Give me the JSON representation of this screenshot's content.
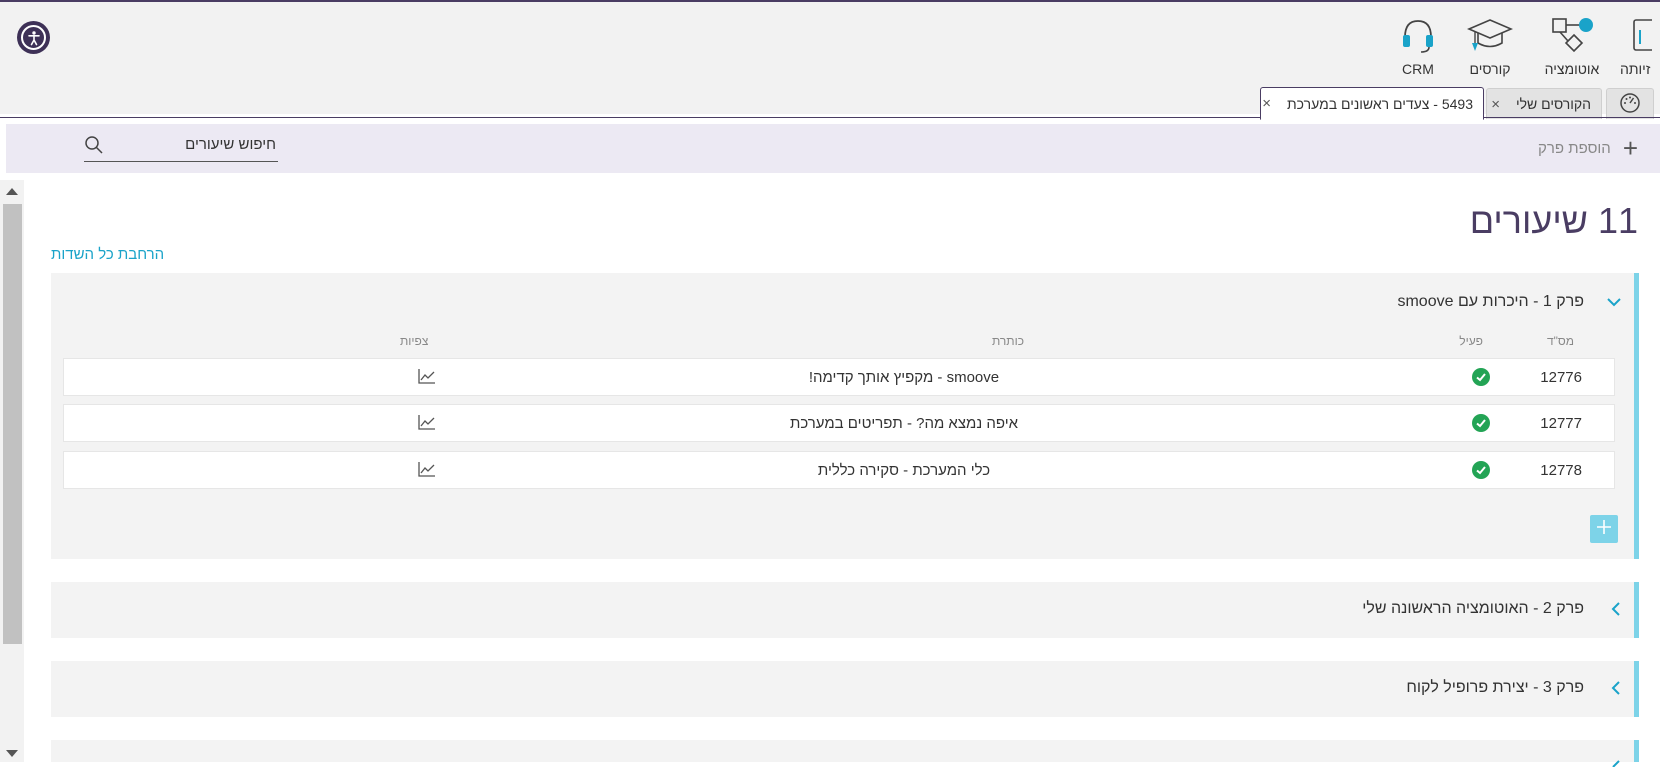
{
  "toolbar": {
    "items": [
      {
        "label": "זיותה",
        "icon": "document-icon"
      },
      {
        "label": "אוטומציה",
        "icon": "flow-icon"
      },
      {
        "label": "קורסים",
        "icon": "graduation-cap-icon"
      },
      {
        "label": "CRM",
        "icon": "headset-icon"
      }
    ],
    "accessibility_icon": "accessibility-icon"
  },
  "tabs": [
    {
      "label": "5493 - צעדים ראשונים במערכת",
      "close": "×",
      "active": true
    },
    {
      "label": "הקורסים שלי",
      "close": "×",
      "active": false
    }
  ],
  "actionbar": {
    "add_chapter_label": "הוספת פרק",
    "add_chapter_symbol": "+",
    "search_placeholder": "חיפוש שיעורים"
  },
  "main": {
    "title": "11 שיעורים",
    "expand_all": "הרחבת כל השדות",
    "columns": {
      "id": "מס\"ד",
      "active": "פעיל",
      "title": "כותרת",
      "views": "צפיות"
    },
    "chapters": [
      {
        "title": "פרק 1 - היכרות עם smoove",
        "expanded": true,
        "lessons": [
          {
            "id": "12776",
            "active": true,
            "title": "smoove - מקפיץ אותך קדימה!"
          },
          {
            "id": "12777",
            "active": true,
            "title": "איפה נמצא מה? - תפריטים במערכת"
          },
          {
            "id": "12778",
            "active": true,
            "title": "כלי המערכת - סקירה כללית"
          }
        ]
      },
      {
        "title": "פרק 2 - האוטומציה הראשונה שלי",
        "expanded": false
      },
      {
        "title": "פרק 3 - יצירת פרופיל לקוח",
        "expanded": false
      }
    ]
  },
  "colors": {
    "brand": "#4a3d63",
    "accent": "#1aa3c9",
    "chapter_border": "#7dd3e8",
    "success": "#23a455"
  }
}
